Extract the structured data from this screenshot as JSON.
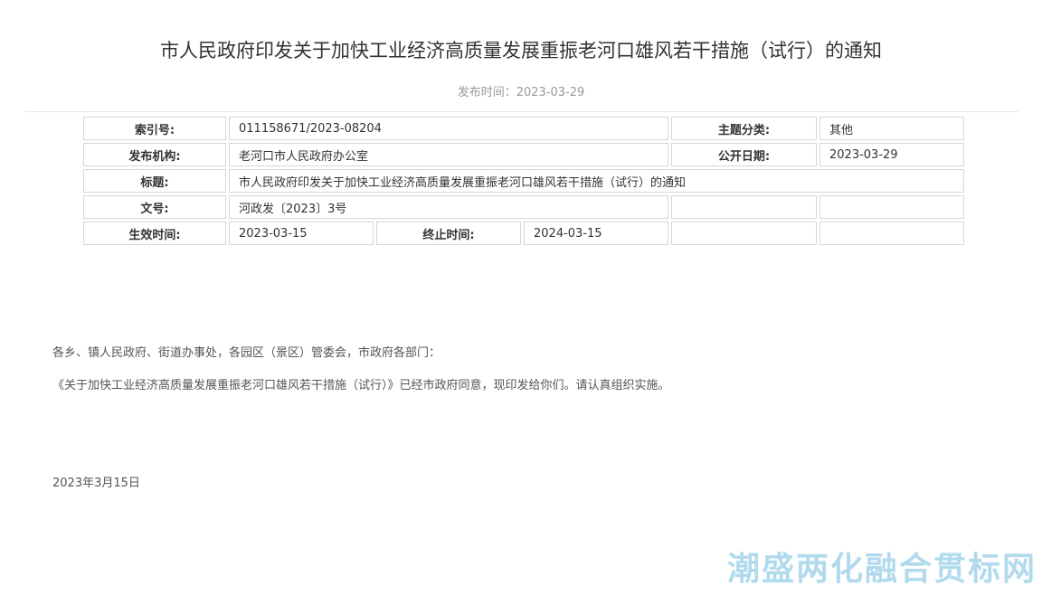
{
  "article": {
    "title": "市人民政府印发关于加快工业经济高质量发展重振老河口雄风若干措施（试行）的通知",
    "publish_label": "发布时间：2023-03-29"
  },
  "meta": {
    "index_label": "索引号:",
    "index_value": "011158671/2023-08204",
    "category_label": "主题分类:",
    "category_value": "其他",
    "issuer_label": "发布机构:",
    "issuer_value": "老河口市人民政府办公室",
    "open_date_label": "公开日期:",
    "open_date_value": "2023-03-29",
    "title_label": "标题:",
    "title_value": "市人民政府印发关于加快工业经济高质量发展重振老河口雄风若干措施（试行）的通知",
    "doc_no_label": "文号:",
    "doc_no_value": "河政发〔2023〕3号",
    "effective_label": "生效时间:",
    "effective_value": "2023-03-15",
    "expire_label": "终止时间:",
    "expire_value": "2024-03-15"
  },
  "content": {
    "greeting": "各乡、镇人民政府、街道办事处，各园区（景区）管委会，市政府各部门：",
    "paragraph": "《关于加快工业经济高质量发展重振老河口雄风若干措施（试行）》已经市政府同意，现印发给你们。请认真组织实施。",
    "sign_date": "2023年3月15日"
  },
  "watermark": {
    "text": "潮盛两化融合贯标网",
    "color": "#a9d6ec"
  }
}
